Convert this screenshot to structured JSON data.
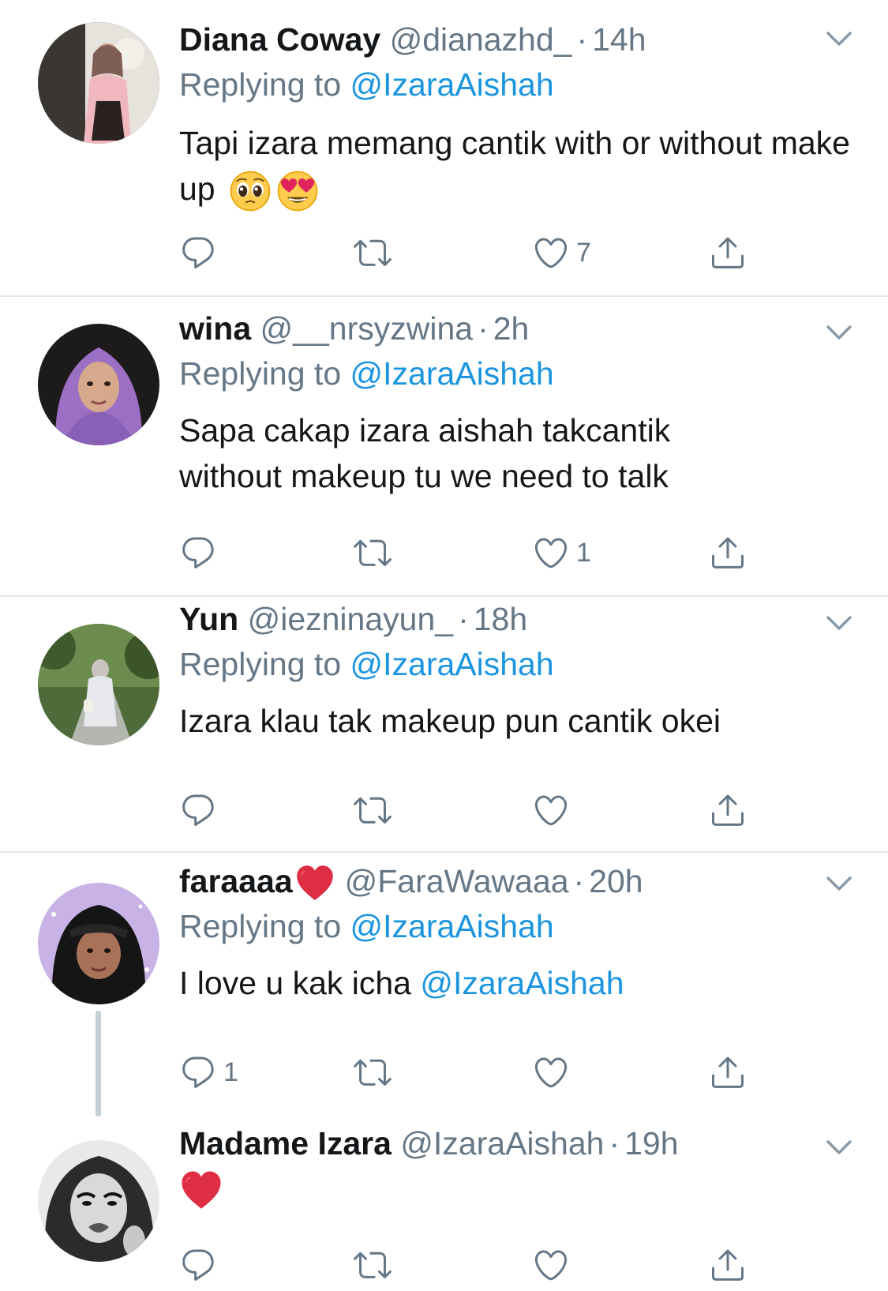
{
  "colors": {
    "accent": "#1b95e0",
    "secondary_text": "#657786",
    "primary_text": "#14171a",
    "divider": "#e1e8ed",
    "like_red": "#e0245e"
  },
  "tweets": [
    {
      "name": "Diana Coway",
      "handle": "@dianazhd_",
      "time": "14h",
      "replying_prefix": "Replying to",
      "replying_to": "@IzaraAishah",
      "text": "Tapi izara memang cantik with or without make up",
      "emojis": [
        "pleading-face-emoji",
        "heart-eyes-emoji"
      ],
      "reply_count": "",
      "retweet_count": "",
      "like_count": "7"
    },
    {
      "name": "wina",
      "handle": "@__nrsyzwina",
      "time": "2h",
      "replying_prefix": "Replying to",
      "replying_to": "@IzaraAishah",
      "text_line1": "Sapa cakap izara aishah takcantik",
      "text_line2": "without makeup tu we need to talk",
      "reply_count": "",
      "retweet_count": "",
      "like_count": "1"
    },
    {
      "name": "Yun",
      "handle": "@iezninayun_",
      "time": "18h",
      "replying_prefix": "Replying to",
      "replying_to": "@IzaraAishah",
      "text": "Izara klau tak makeup pun cantik okei",
      "reply_count": "",
      "retweet_count": "",
      "like_count": ""
    },
    {
      "name": "faraaaa",
      "name_emoji": "red-heart-emoji",
      "handle": "@FaraWawaaa",
      "time": "20h",
      "replying_prefix": "Replying to",
      "replying_to": "@IzaraAishah",
      "text": "I love u kak icha",
      "text_mention": "@IzaraAishah",
      "reply_count": "1",
      "retweet_count": "",
      "like_count": ""
    },
    {
      "name": "Madame Izara",
      "handle": "@IzaraAishah",
      "time": "19h",
      "body_emoji": "red-heart-emoji",
      "reply_count": "",
      "retweet_count": "",
      "like_count": ""
    }
  ],
  "separator": "·"
}
